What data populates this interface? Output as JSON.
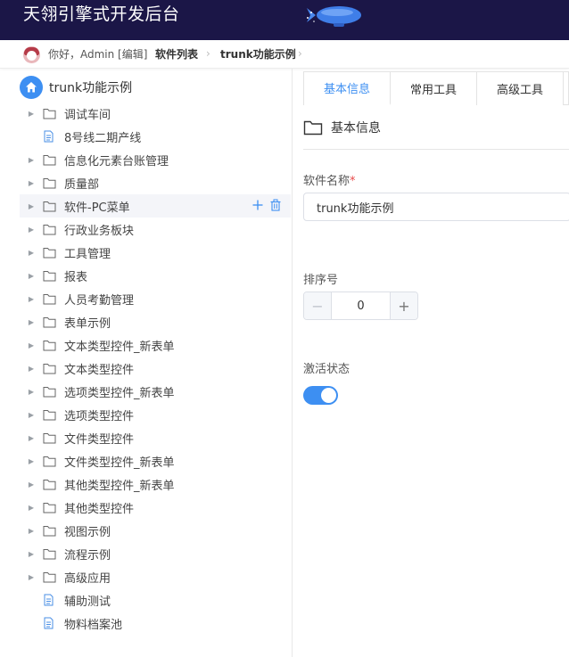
{
  "header": {
    "title": "天翎引擎式开发后台"
  },
  "breadcrumb": {
    "greeting": "你好，Admin [编辑]",
    "items": [
      "软件列表",
      "trunk功能示例"
    ]
  },
  "tree": {
    "root": "trunk功能示例",
    "nodes": [
      {
        "label": "调试车间",
        "type": "folder"
      },
      {
        "label": "8号线二期产线",
        "type": "file"
      },
      {
        "label": "信息化元素台账管理",
        "type": "folder"
      },
      {
        "label": "质量部",
        "type": "folder"
      },
      {
        "label": "软件-PC菜单",
        "type": "folder",
        "active": true
      },
      {
        "label": "行政业务板块",
        "type": "folder"
      },
      {
        "label": "工具管理",
        "type": "folder"
      },
      {
        "label": "报表",
        "type": "folder"
      },
      {
        "label": "人员考勤管理",
        "type": "folder"
      },
      {
        "label": "表单示例",
        "type": "folder"
      },
      {
        "label": "文本类型控件_新表单",
        "type": "folder"
      },
      {
        "label": "文本类型控件",
        "type": "folder"
      },
      {
        "label": "选项类型控件_新表单",
        "type": "folder"
      },
      {
        "label": "选项类型控件",
        "type": "folder"
      },
      {
        "label": "文件类型控件",
        "type": "folder"
      },
      {
        "label": "文件类型控件_新表单",
        "type": "folder"
      },
      {
        "label": "其他类型控件_新表单",
        "type": "folder"
      },
      {
        "label": "其他类型控件",
        "type": "folder"
      },
      {
        "label": "视图示例",
        "type": "folder"
      },
      {
        "label": "流程示例",
        "type": "folder"
      },
      {
        "label": "高级应用",
        "type": "folder"
      },
      {
        "label": "辅助测试",
        "type": "file"
      },
      {
        "label": "物料档案池",
        "type": "file"
      }
    ]
  },
  "tabs": [
    "基本信息",
    "常用工具",
    "高级工具"
  ],
  "form": {
    "section_title": "基本信息",
    "name_label": "软件名称",
    "name_required": "*",
    "name_value": "trunk功能示例",
    "order_label": "排序号",
    "order_value": "0",
    "active_label": "激活状态",
    "active_on": true
  },
  "colors": {
    "header_bg": "#1b1647",
    "accent": "#3d8ff2"
  }
}
